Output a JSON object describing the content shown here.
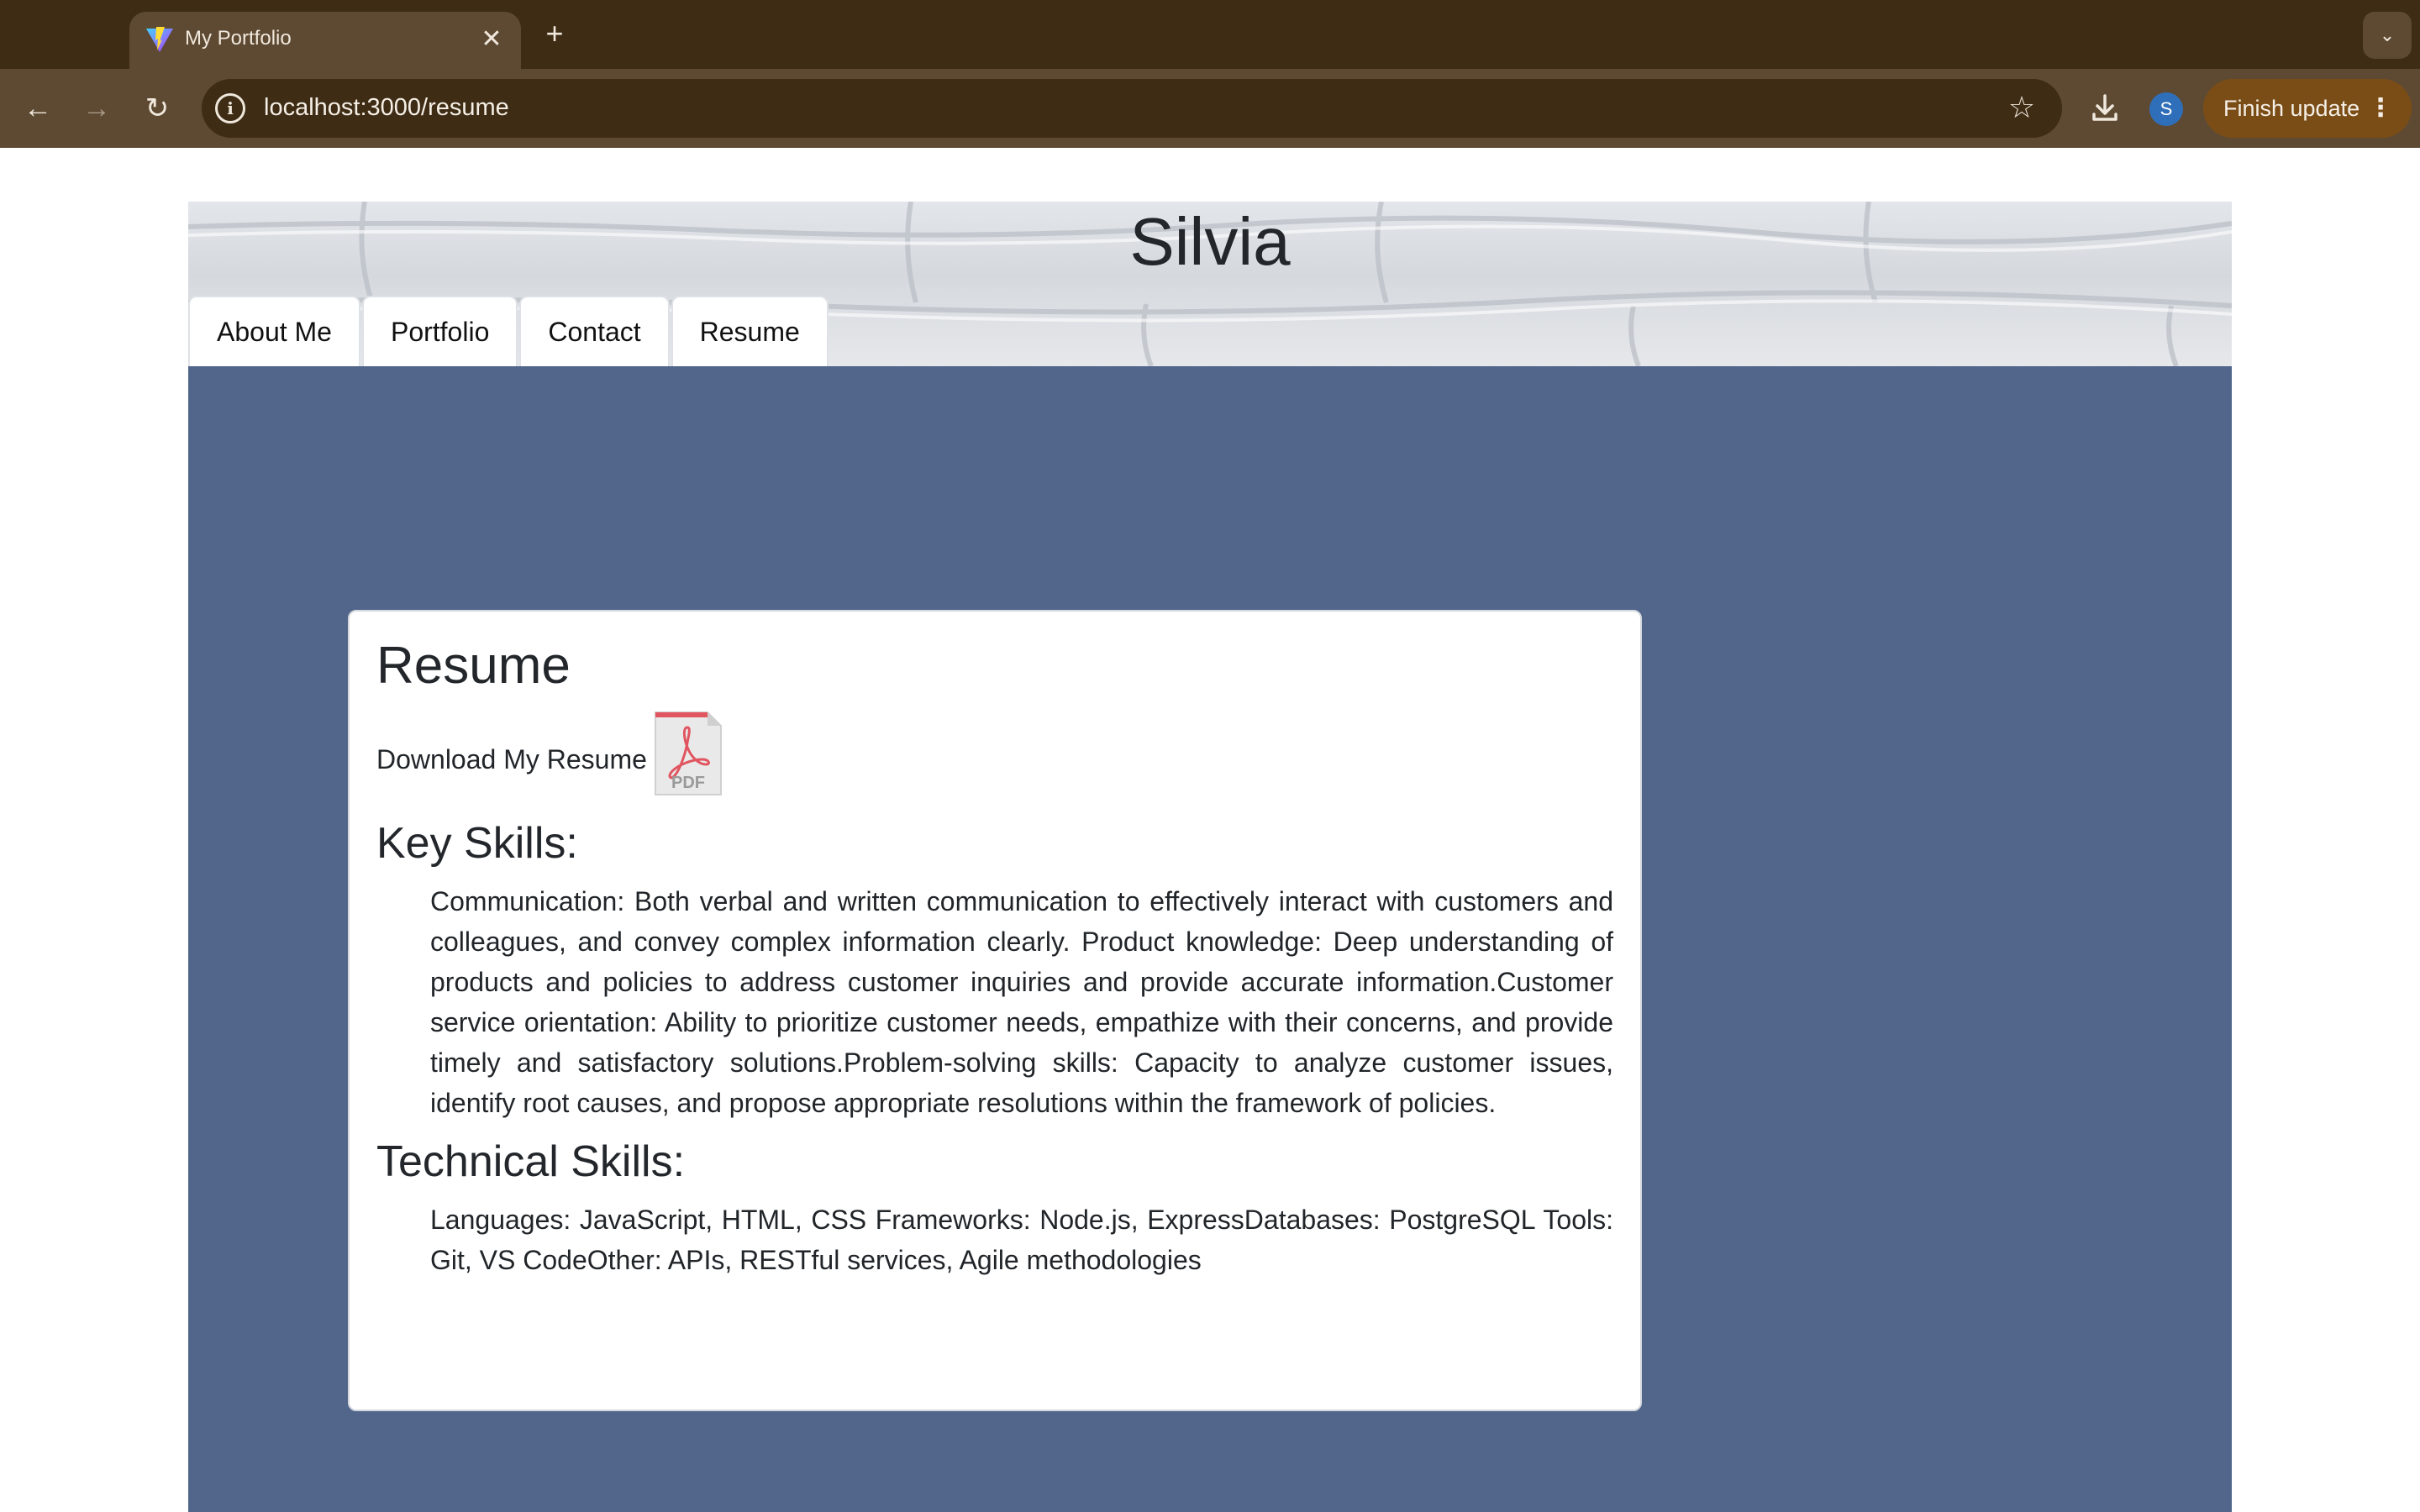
{
  "browser": {
    "tab_title": "My Portfolio",
    "url": "localhost:3000/resume",
    "profile_initial": "S",
    "finish_update_label": "Finish update",
    "icons": [
      "back-arrow-icon",
      "forward-arrow-icon",
      "reload-icon",
      "site-info-icon",
      "star-icon",
      "download-icon",
      "tab-search-chevron-icon",
      "close-icon",
      "plus-icon",
      "kebab-menu-icon"
    ]
  },
  "site": {
    "name": "Silvia",
    "nav": [
      {
        "label": "About Me"
      },
      {
        "label": "Portfolio"
      },
      {
        "label": "Contact"
      },
      {
        "label": "Resume"
      }
    ]
  },
  "resume": {
    "title": "Resume",
    "download_label": "Download My Resume",
    "pdf_icon_text": "PDF",
    "key_skills_heading": "Key Skills:",
    "key_skills_text": "Communication: Both verbal and written communication to effectively interact with customers and colleagues, and convey complex information clearly. Product knowledge: Deep understanding of products and policies to address customer inquiries and provide accurate information.Customer service orientation: Ability to prioritize customer needs, empathize with their concerns, and provide timely and satisfactory solutions.Problem-solving skills: Capacity to analyze customer issues, identify root causes, and propose appropriate resolutions within the framework of policies.",
    "technical_skills_heading": "Technical Skills:",
    "technical_skills_text": "Languages: JavaScript, HTML, CSS Frameworks: Node.js, ExpressDatabases: PostgreSQL Tools: Git, VS CodeOther: APIs, RESTful services, Agile methodologies"
  },
  "colors": {
    "tabstrip": "#3e2c15",
    "toolbar": "#5e4a33",
    "content_background": "#52668c",
    "card_background": "#ffffff",
    "avatar": "#2f6fba",
    "finish_update": "#7a4d17"
  }
}
